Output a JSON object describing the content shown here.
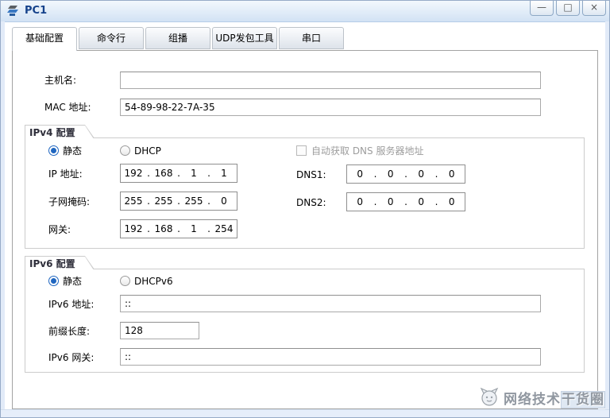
{
  "window": {
    "title": "PC1",
    "minimize_glyph": "—",
    "maximize_glyph": "□",
    "close_glyph": "×"
  },
  "tabs": [
    {
      "label": "基础配置",
      "active": true
    },
    {
      "label": "命令行",
      "active": false
    },
    {
      "label": "组播",
      "active": false
    },
    {
      "label": "UDP发包工具",
      "active": false
    },
    {
      "label": "串口",
      "active": false
    }
  ],
  "basic": {
    "hostname_label": "主机名:",
    "hostname_value": "",
    "mac_label": "MAC 地址:",
    "mac_value": "54-89-98-22-7A-35"
  },
  "ipv4": {
    "group_title": "IPv4 配置",
    "static_label": "静态",
    "static_selected": true,
    "dhcp_label": "DHCP",
    "dhcp_selected": false,
    "auto_dns_label": "自动获取 DNS 服务器地址",
    "auto_dns_checked": false,
    "ip_label": "IP 地址:",
    "ip_value": [
      "192",
      "168",
      "1",
      "1"
    ],
    "mask_label": "子网掩码:",
    "mask_value": [
      "255",
      "255",
      "255",
      "0"
    ],
    "gateway_label": "网关:",
    "gateway_value": [
      "192",
      "168",
      "1",
      "254"
    ],
    "dns1_label": "DNS1:",
    "dns1_value": [
      "0",
      "0",
      "0",
      "0"
    ],
    "dns2_label": "DNS2:",
    "dns2_value": [
      "0",
      "0",
      "0",
      "0"
    ]
  },
  "ipv6": {
    "group_title": "IPv6 配置",
    "static_label": "静态",
    "static_selected": true,
    "dhcpv6_label": "DHCPv6",
    "dhcpv6_selected": false,
    "address_label": "IPv6 地址:",
    "address_value": "::",
    "prefix_label": "前缀长度:",
    "prefix_value": "128",
    "gateway_label": "IPv6 网关:",
    "gateway_value": "::"
  },
  "ui": {
    "ip_dot": "."
  },
  "watermark": {
    "text_pre": "网络技术",
    "text_hl": "干货圈"
  },
  "colors": {
    "accent_blue": "#1f66c0",
    "title_text": "#15428b",
    "titlebar_from": "#f2f8fd",
    "titlebar_to": "#d2e2f4",
    "frame_blue": "#e2ebf8",
    "disabled_text": "#9d9d9d"
  }
}
